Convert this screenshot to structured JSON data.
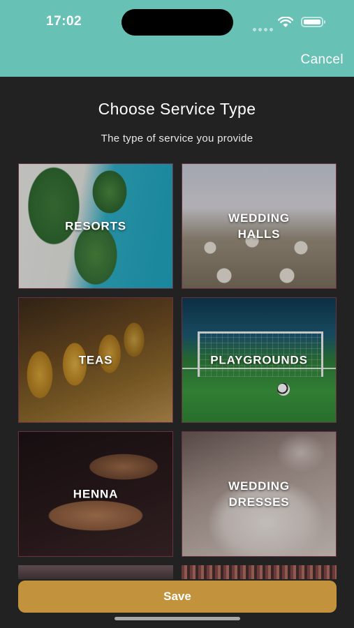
{
  "status_bar": {
    "time": "17:02"
  },
  "header": {
    "cancel_label": "Cancel"
  },
  "page": {
    "title": "Choose Service Type",
    "subtitle": "The type of service you provide"
  },
  "services": [
    {
      "label": "RESORTS"
    },
    {
      "label": "WEDDING HALLS"
    },
    {
      "label": "TEAS"
    },
    {
      "label": "PLAYGROUNDS"
    },
    {
      "label": "HENNA"
    },
    {
      "label": "WEDDING DRESSES"
    }
  ],
  "footer": {
    "save_label": "Save"
  },
  "colors": {
    "header_bg": "#68c1b5",
    "page_bg": "#222222",
    "save_button": "#c2923d",
    "tile_border": "#6b3140"
  },
  "icons": [
    "wifi-icon",
    "battery-icon"
  ]
}
